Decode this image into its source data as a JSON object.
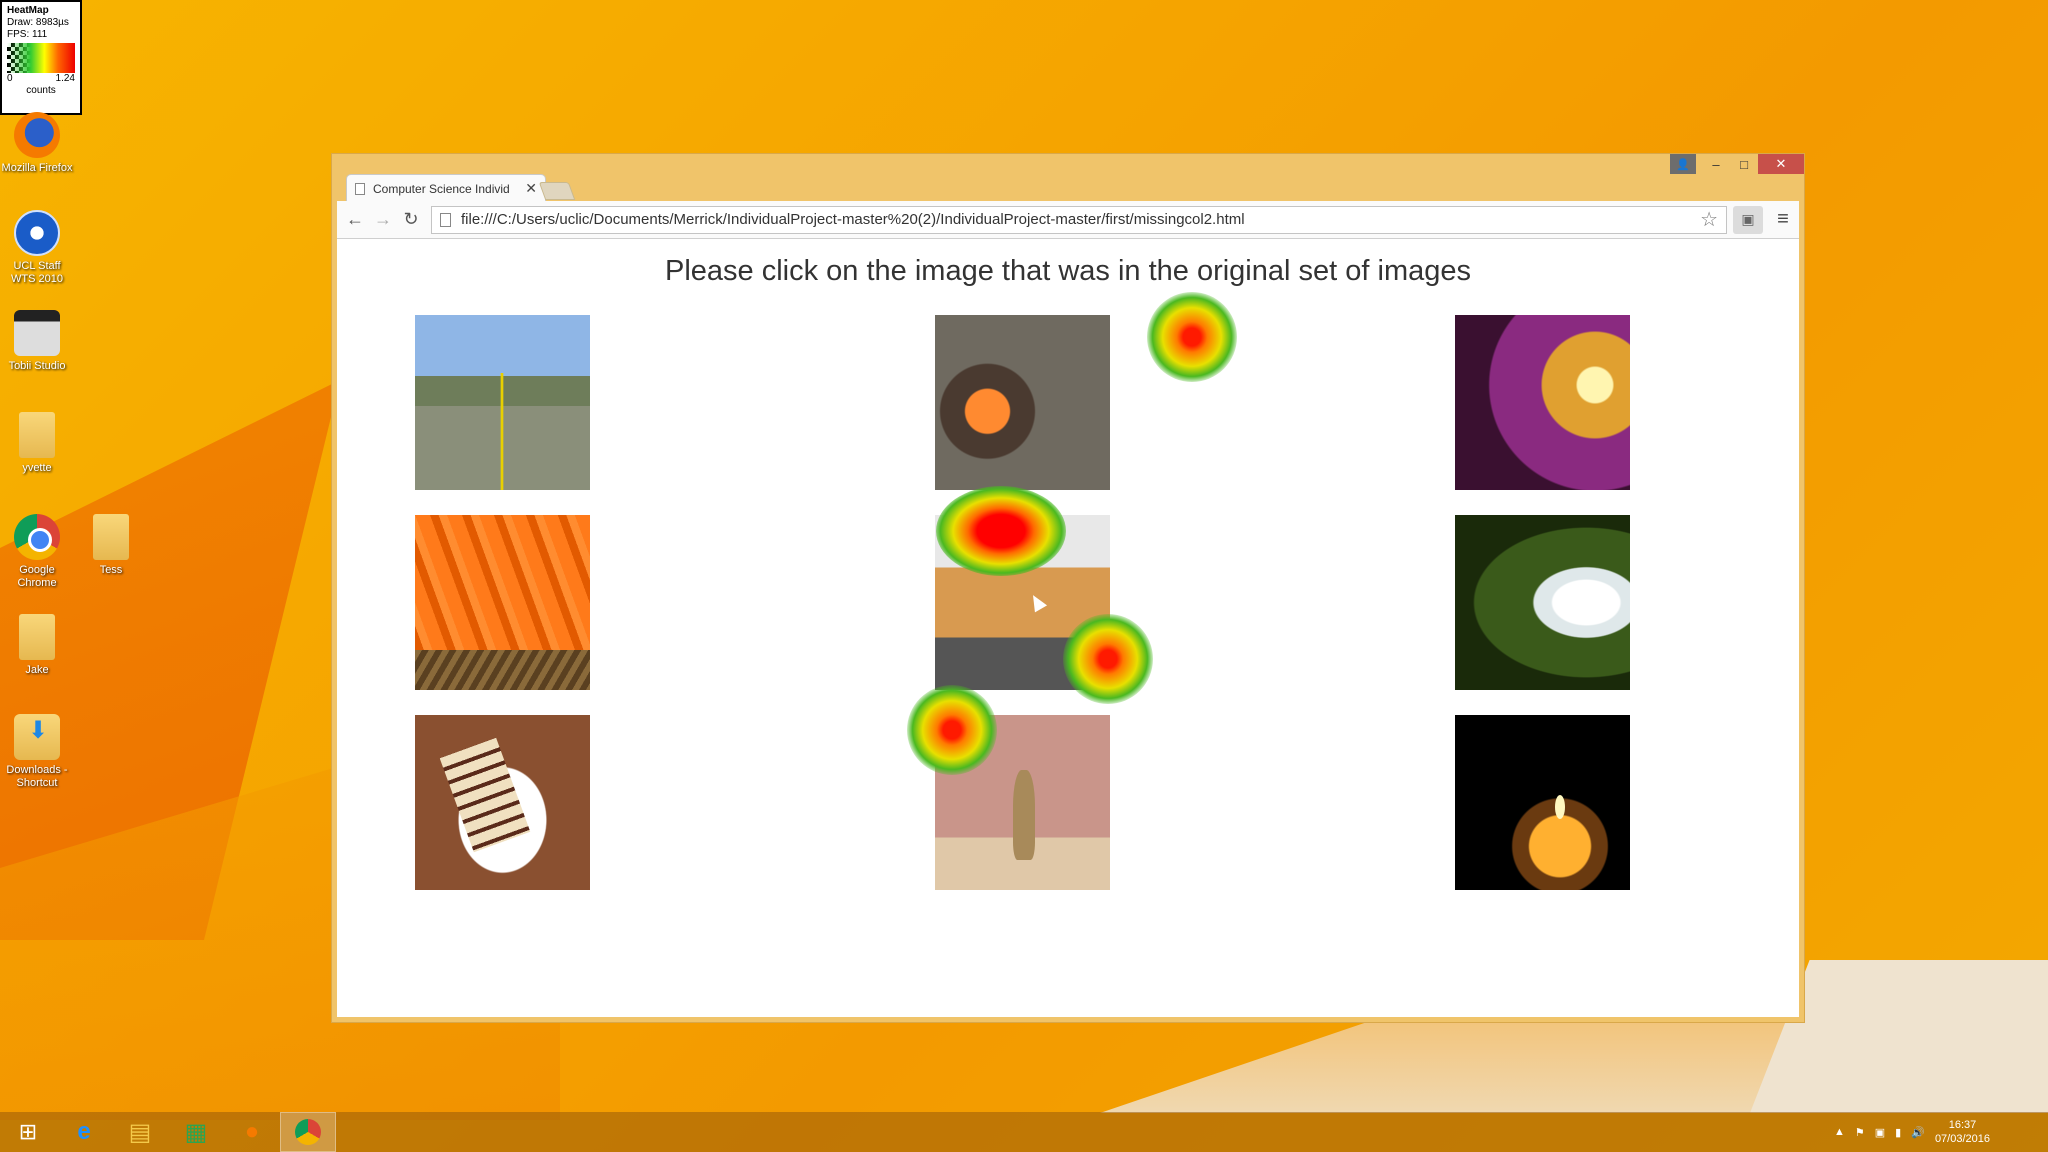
{
  "heatmap_legend": {
    "title": "HeatMap",
    "draw": "Draw: 8983µs",
    "fps": "FPS: 111",
    "min": "0",
    "max": "1.24",
    "unit": "counts"
  },
  "desktop_icons": [
    {
      "label": "Mozilla Firefox",
      "icon": "firefox-icon"
    },
    {
      "label": "UCL Staff WTS 2010",
      "icon": "remote-desktop-icon"
    },
    {
      "label": "Tobii Studio",
      "icon": "tobii-icon"
    },
    {
      "label": "yvette",
      "icon": "folder-icon"
    },
    {
      "label": "Google Chrome",
      "icon": "chrome-icon"
    },
    {
      "label": "Tess",
      "icon": "folder-icon"
    },
    {
      "label": "Jake",
      "icon": "folder-icon"
    },
    {
      "label": "Downloads - Shortcut",
      "icon": "downloads-folder-icon"
    }
  ],
  "browser": {
    "tab_title": "Computer Science Individ",
    "url": "file:///C:/Users/uclic/Documents/Merrick/IndividualProject-master%20(2)/IndividualProject-master/first/missingcol2.html",
    "window_controls": {
      "minimize": "–",
      "maximize": "□",
      "close": "✕"
    }
  },
  "page": {
    "heading": "Please click on the image that was in the original set of images",
    "images": [
      {
        "name": "road",
        "fill": "p-road"
      },
      {
        "name": "lantern",
        "fill": "p-lantern"
      },
      {
        "name": "saxophone",
        "fill": "p-sax"
      },
      {
        "name": "carrots",
        "fill": "p-carrots"
      },
      {
        "name": "toast",
        "fill": "p-toast"
      },
      {
        "name": "waterfall",
        "fill": "p-waterfall"
      },
      {
        "name": "cake",
        "fill": "p-cake"
      },
      {
        "name": "meerkat",
        "fill": "p-meerkat"
      },
      {
        "name": "candle",
        "fill": "p-candle"
      }
    ]
  },
  "taskbar": {
    "items": [
      "start-icon",
      "internet-explorer-icon",
      "file-explorer-icon",
      "store-icon",
      "firefox-icon",
      "chrome-icon"
    ],
    "time": "16:37",
    "date": "07/03/2016"
  },
  "colors": {
    "window_frame": "#f0c46a",
    "close_button": "#c7504a",
    "heat_peak": "#ff0000"
  }
}
